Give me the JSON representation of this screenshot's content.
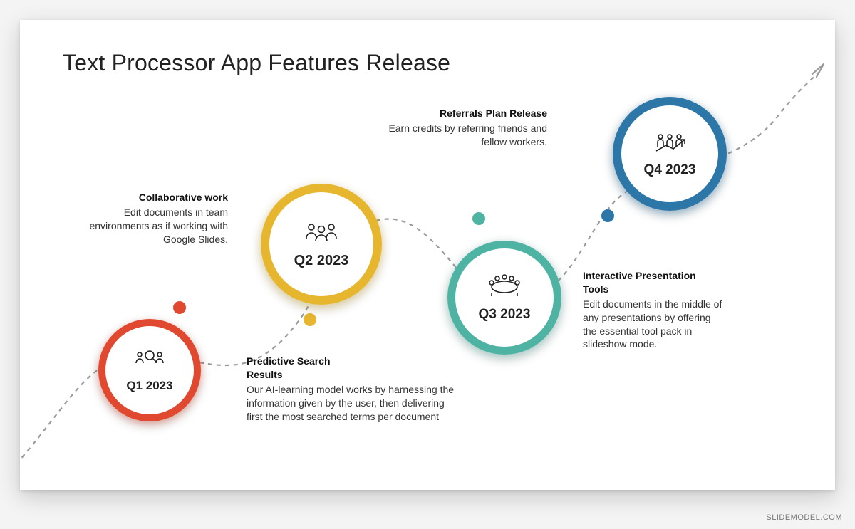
{
  "title": "Text Processor App Features Release",
  "footer": "SLIDEMODEL.COM",
  "colors": {
    "q1": "#E0492F",
    "q2": "#E6B62F",
    "q3": "#4FB3A3",
    "q4": "#2C77A8"
  },
  "milestones": {
    "q1": {
      "label": "Q1 2023",
      "feature_title": "Predictive Search Results",
      "feature_body": "Our AI-learning model works by harnessing the information given by the user, then delivering first the most searched terms per document"
    },
    "q2": {
      "label": "Q2 2023",
      "feature_title": "Collaborative work",
      "feature_body": "Edit documents in team environments as if working with Google Slides."
    },
    "q3": {
      "label": "Q3 2023",
      "feature_title": "Interactive Presentation Tools",
      "feature_body": "Edit documents in the middle of any presentations by offering the essential tool pack in slideshow mode."
    },
    "q4": {
      "label": "Q4 2023",
      "feature_title": "Referrals Plan Release",
      "feature_body": "Earn credits by referring friends and fellow workers."
    }
  }
}
